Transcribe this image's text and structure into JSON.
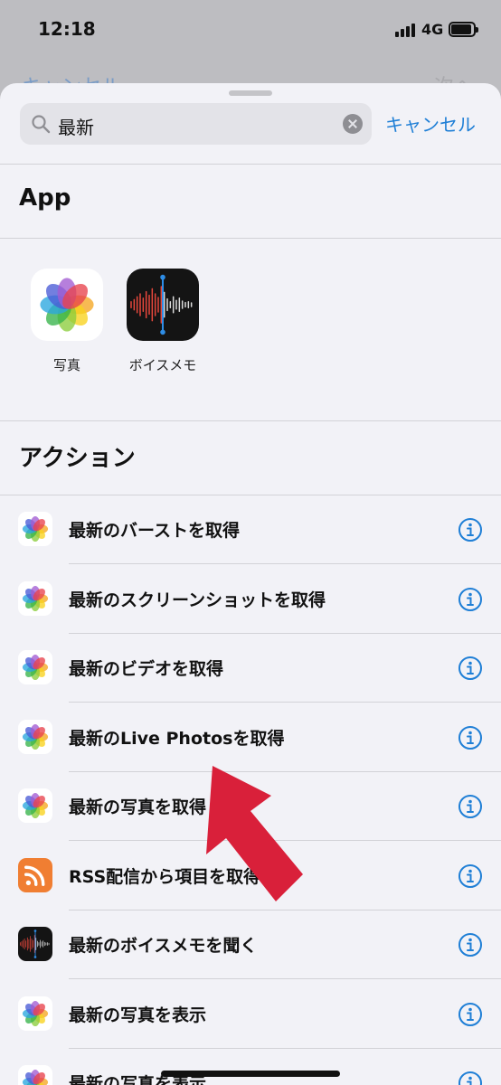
{
  "status_bar": {
    "time": "12:18",
    "network": "4G"
  },
  "background": {
    "cancel_label": "キャンセル",
    "next_label": "次へ"
  },
  "search": {
    "query": "最新",
    "cancel_label": "キャンセル"
  },
  "sections": {
    "app_title": "App",
    "actions_title": "アクション"
  },
  "apps": [
    {
      "label": "写真",
      "icon": "photos-icon"
    },
    {
      "label": "ボイスメモ",
      "icon": "voice-memos-icon"
    }
  ],
  "actions": [
    {
      "label": "最新のバーストを取得",
      "icon": "photos-icon"
    },
    {
      "label": "最新のスクリーンショットを取得",
      "icon": "photos-icon"
    },
    {
      "label": "最新のビデオを取得",
      "icon": "photos-icon"
    },
    {
      "label": "最新のLive Photosを取得",
      "icon": "photos-icon"
    },
    {
      "label": "最新の写真を取得",
      "icon": "photos-icon"
    },
    {
      "label": "RSS配信から項目を取得",
      "icon": "rss-icon"
    },
    {
      "label": "最新のボイスメモを聞く",
      "icon": "voice-memos-icon"
    },
    {
      "label": "最新の写真を表示",
      "icon": "photos-icon"
    },
    {
      "label": "最新の写真を表示",
      "icon": "photos-icon"
    }
  ],
  "colors": {
    "accent": "#1f7fd6",
    "annotation_arrow": "#d9203a",
    "rss": "#f07e32"
  }
}
